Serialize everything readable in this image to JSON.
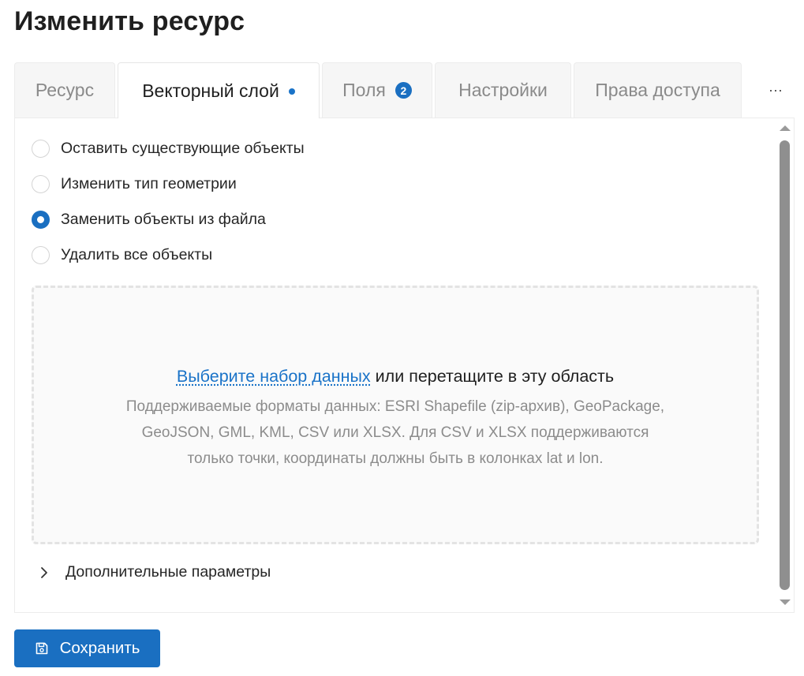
{
  "page": {
    "title": "Изменить ресурс"
  },
  "tabs": [
    {
      "label": "Ресурс",
      "active": false
    },
    {
      "label": "Векторный слой",
      "active": true,
      "dot": true
    },
    {
      "label": "Поля",
      "active": false,
      "badge": "2"
    },
    {
      "label": "Настройки",
      "active": false
    },
    {
      "label": "Права доступа",
      "active": false
    }
  ],
  "tabs_more": "···",
  "radio_options": [
    {
      "label": "Оставить существующие объекты",
      "checked": false
    },
    {
      "label": "Изменить тип геометрии",
      "checked": false
    },
    {
      "label": "Заменить объекты из файла",
      "checked": true
    },
    {
      "label": "Удалить все объекты",
      "checked": false
    }
  ],
  "dropzone": {
    "link_text": "Выберите набор данных",
    "main_text": " или перетащите в эту область",
    "hint_lines": [
      "Поддерживаемые форматы данных: ESRI Shapefile (zip-архив), GeoPackage,",
      "GeoJSON, GML, KML, CSV или XLSX. Для CSV и XLSX поддерживаются",
      "только точки, координаты должны быть в колонках lat и lon."
    ]
  },
  "advanced": {
    "label": "Дополнительные параметры",
    "icon": "chevron-right-icon"
  },
  "save_button": {
    "label": "Сохранить",
    "icon": "save-icon"
  },
  "colors": {
    "accent": "#1a6fc1",
    "link": "#1a73c8",
    "tab_inactive_bg": "#f6f6f6",
    "hint_text": "#8c8c8c"
  }
}
